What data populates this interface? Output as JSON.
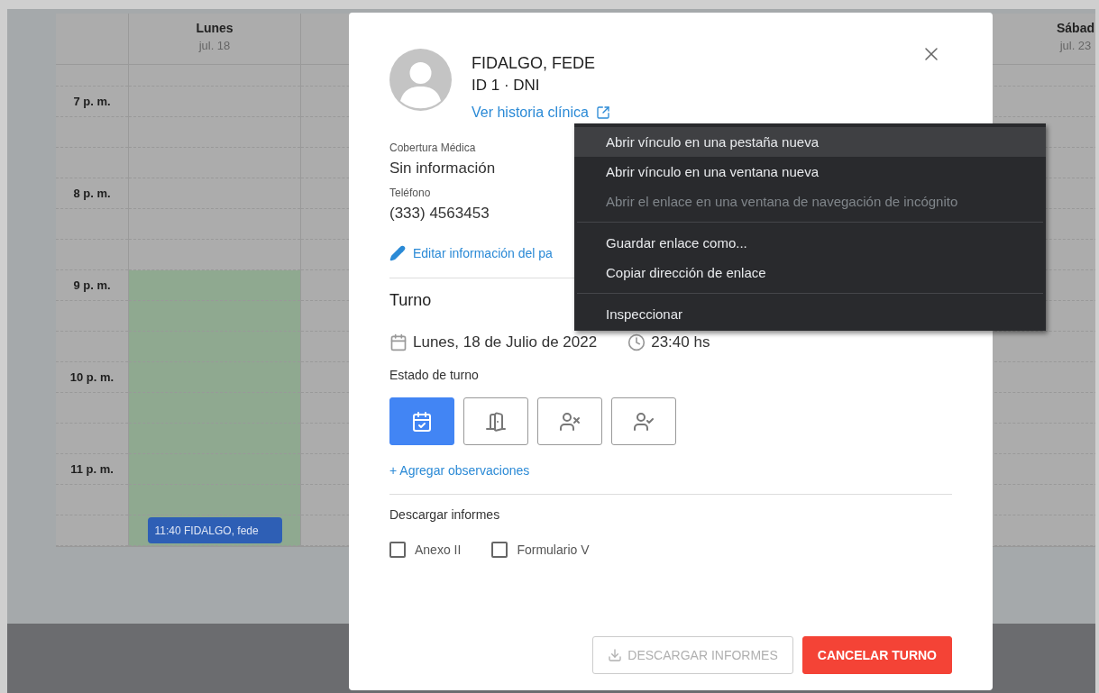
{
  "calendar": {
    "hours": [
      "7 p. m.",
      "8 p. m.",
      "9 p. m.",
      "10 p. m.",
      "11 p. m."
    ],
    "days": [
      {
        "name": "Lunes",
        "date": "jul. 18",
        "open_hours": [
          false,
          false,
          true,
          true,
          true
        ],
        "event": "11:40 FIDALGO, fede"
      },
      {
        "name": "Sábad",
        "date": "jul. 23",
        "open_hours": [
          false,
          false,
          false,
          false,
          false
        ]
      }
    ]
  },
  "modal": {
    "patient": {
      "name": "FIDALGO, FEDE",
      "id_line": "ID 1 · DNI",
      "history_link": "Ver historia clínica"
    },
    "fields": [
      {
        "label": "Cobertura Médica",
        "value": "Sin información"
      },
      {
        "label": "Teléfono",
        "value": "(333) 4563453"
      }
    ],
    "edit_link": "Editar información del pa",
    "appointment": {
      "title": "Turno",
      "date": "Lunes, 18 de Julio de 2022",
      "time": "23:40 hs",
      "status_label": "Estado de turno",
      "status_options": [
        {
          "kind": "scheduled",
          "selected": true
        },
        {
          "kind": "arrived",
          "selected": false
        },
        {
          "kind": "absent",
          "selected": false
        },
        {
          "kind": "attended",
          "selected": false
        }
      ],
      "notes_link": "+ Agregar observaciones"
    },
    "reports": {
      "title": "Descargar informes",
      "options": [
        {
          "label": "Anexo II",
          "checked": false
        },
        {
          "label": "Formulario V",
          "checked": false
        }
      ]
    },
    "buttons": [
      {
        "kind": "download",
        "label": "DESCARGAR INFORMES",
        "disabled": true
      },
      {
        "kind": "danger",
        "label": "CANCELAR TURNO",
        "disabled": false
      }
    ]
  },
  "context_menu": [
    {
      "kind": "item",
      "label": "Abrir vínculo en una pestaña nueva",
      "selected": true,
      "disabled": false
    },
    {
      "kind": "item",
      "label": "Abrir vínculo en una ventana nueva",
      "selected": false,
      "disabled": false
    },
    {
      "kind": "item",
      "label": "Abrir el enlace en una ventana de navegación de incógnito",
      "selected": false,
      "disabled": true
    },
    {
      "kind": "separator"
    },
    {
      "kind": "item",
      "label": "Guardar enlace como...",
      "selected": false,
      "disabled": false
    },
    {
      "kind": "item",
      "label": "Copiar dirección de enlace",
      "selected": false,
      "disabled": false
    },
    {
      "kind": "separator"
    },
    {
      "kind": "item",
      "label": "Inspeccionar",
      "selected": false,
      "disabled": false
    }
  ]
}
